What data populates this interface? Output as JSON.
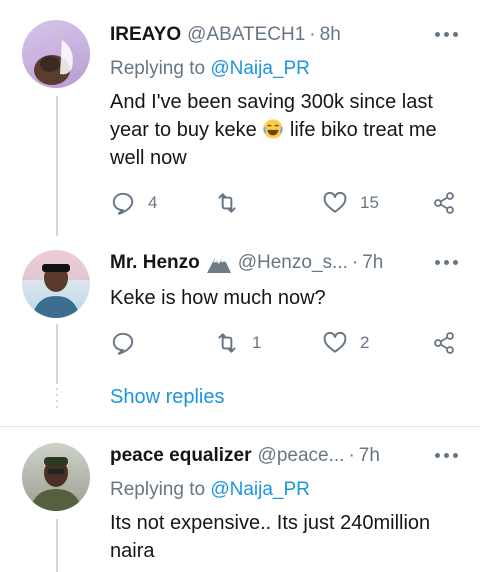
{
  "tweets": [
    {
      "name": "IREAYO",
      "handle": "@ABATECH1",
      "dot": "·",
      "time": "8h",
      "replying_prefix": "Replying to",
      "replying_to": "@Naija_PR",
      "text_line1": "And I've been saving 300k since last",
      "text_line2_a": "year to buy keke",
      "text_line2_b": "life biko treat me",
      "text_line3": "well now",
      "reply_count": "4",
      "retweet_count": "",
      "like_count": "15"
    },
    {
      "name": "Mr. Henzo",
      "handle": "@Henzo_s...",
      "dot": "·",
      "time": "7h",
      "text_line1": "Keke is how much now?",
      "reply_count": "",
      "retweet_count": "1",
      "like_count": "2",
      "show_replies": "Show replies"
    },
    {
      "name": "peace equalizer",
      "handle": "@peace...",
      "dot": "·",
      "time": "7h",
      "replying_prefix": "Replying to",
      "replying_to": "@Naija_PR",
      "text_line1": "Its not expensive.. Its just 240million",
      "text_line2": "naira"
    }
  ],
  "colors": {
    "accent": "#1b95e0",
    "secondary_text": "#687684",
    "primary_text": "#14171a",
    "divider": "#e1e8ed"
  },
  "icons": [
    "more-icon",
    "reply-icon",
    "retweet-icon",
    "like-icon",
    "share-icon",
    "laughing-emoji-icon",
    "mountain-emoji-icon"
  ]
}
